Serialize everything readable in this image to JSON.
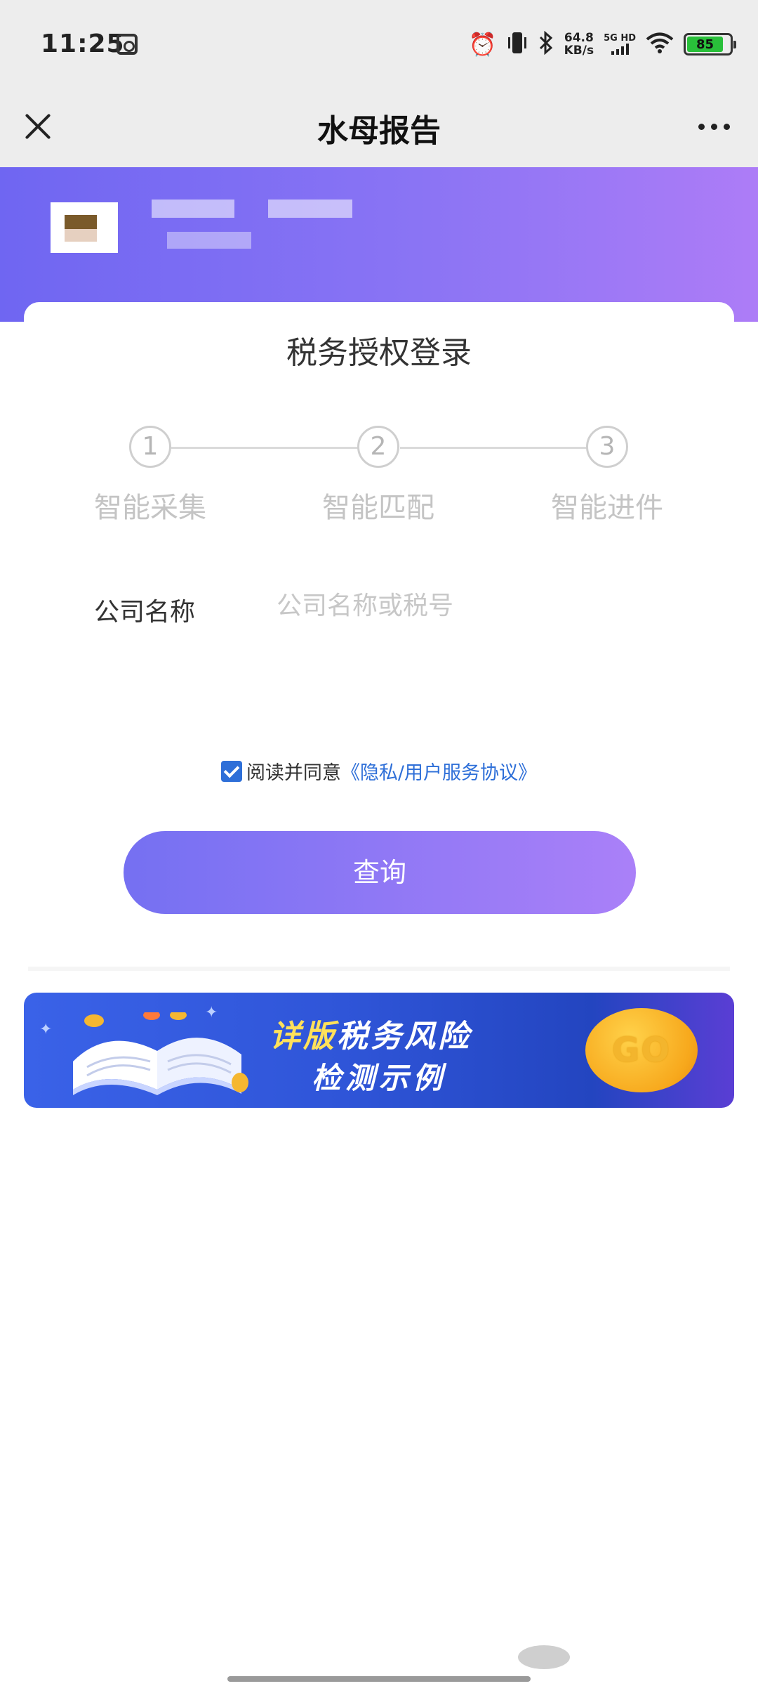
{
  "status_bar": {
    "time": "11:25",
    "net_speed_value": "64.8",
    "net_speed_unit": "KB/s",
    "signal_label": "5G HD",
    "battery": "85"
  },
  "nav": {
    "title": "水母报告"
  },
  "card": {
    "title": "税务授权登录",
    "steps": [
      {
        "number": "1",
        "label": "智能采集"
      },
      {
        "number": "2",
        "label": "智能匹配"
      },
      {
        "number": "3",
        "label": "智能进件"
      }
    ],
    "company_label": "公司名称",
    "company_placeholder": "公司名称或税号",
    "company_value": "",
    "agree_text": "阅读并同意",
    "agree_link": "《隐私/用户服务协议》",
    "agree_checked": true,
    "query_button": "查询"
  },
  "banner": {
    "line1_highlight": "详版",
    "line1_rest": "税务风险",
    "line2": "检测示例",
    "go_label": "GO"
  },
  "colors": {
    "header_gradient_start": "#6f66f2",
    "header_gradient_end": "#ad7cf7",
    "link_blue": "#2e6fd8",
    "battery_green": "#29c03a"
  }
}
